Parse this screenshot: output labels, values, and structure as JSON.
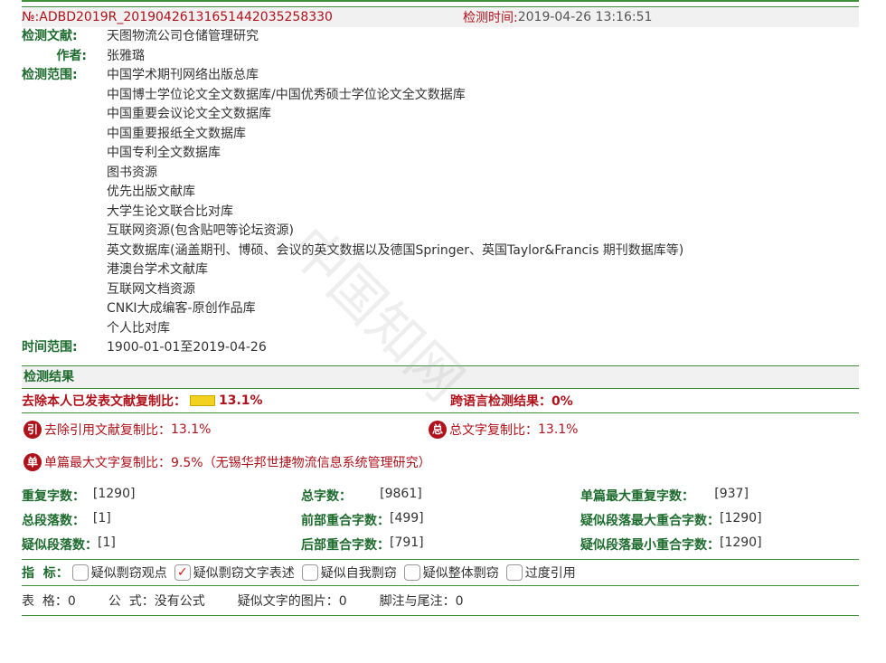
{
  "header": {
    "number": "№:ADBD2019R_2019042613165144203 5258330",
    "time_label": "检测时间:",
    "time_value": "2019-04-26 13:16:51"
  },
  "info": {
    "title_label": "检测文献:",
    "title_value": "天图物流公司仓储管理研究",
    "author_label": "作者:",
    "author_value": "张雅璐",
    "scope_label": "检测范围:",
    "scope": [
      "中国学术期刊网络出版总库",
      "中国博士学位论文全文数据库/中国优秀硕士学位论文全文数据库",
      "中国重要会议论文全文数据库",
      "中国重要报纸全文数据库",
      "中国专利全文数据库",
      "图书资源",
      "优先出版文献库",
      "大学生论文联合比对库",
      "互联网资源(包含贴吧等论坛资源)",
      "英文数据库(涵盖期刊、博硕、会议的英文数据以及德国Springer、英国Taylor&Francis 期刊数据库等)",
      "港澳台学术文献库",
      "互联网文档资源",
      "CNKI大成编客-原创作品库",
      "个人比对库"
    ],
    "time_range_label": "时间范围:",
    "time_range_value": "1900-01-01至2019-04-26"
  },
  "results": {
    "title": "检测结果",
    "excl_self_label": "去除本人已发表文献复制比：",
    "excl_self_value": "13.1%",
    "cross_lang_label": "跨语言检测结果：",
    "cross_lang_value": "0%",
    "excl_cite_icon": "引",
    "excl_cite_label": "去除引用文献复制比：",
    "excl_cite_value": "13.1%",
    "total_icon": "总",
    "total_label": "总文字复制比：",
    "total_value": "13.1%",
    "single_icon": "单",
    "single_label": "单篇最大文字复制比：",
    "single_value": "9.5%（无锡华邦世捷物流信息系统管理研究）"
  },
  "stats": {
    "dup_chars_label": "重复字数：",
    "dup_chars_value": "[1290]",
    "total_chars_label": "总字数：",
    "total_chars_value": "[9861]",
    "single_max_dup_label": "单篇最大重复字数：",
    "single_max_dup_value": "[937]",
    "total_para_label": "总段落数：",
    "total_para_value": "[1]",
    "front_overlap_label": "前部重合字数：",
    "front_overlap_value": "[499]",
    "sus_para_max_label": "疑似段落最大重合字数：",
    "sus_para_max_value": "[1290]",
    "sus_para_label": "疑似段落数：",
    "sus_para_value": "[1]",
    "back_overlap_label": "后部重合字数：",
    "back_overlap_value": "[791]",
    "sus_para_min_label": "疑似段落最小重合字数：",
    "sus_para_min_value": "[1290]"
  },
  "indicators": {
    "label": "指  标：",
    "items": [
      {
        "label": "疑似剽窃观点",
        "checked": false
      },
      {
        "label": "疑似剽窃文字表述",
        "checked": true
      },
      {
        "label": "疑似自我剽窃",
        "checked": false
      },
      {
        "label": "疑似整体剽窃",
        "checked": false
      },
      {
        "label": "过度引用",
        "checked": false
      }
    ],
    "check_mark": "✓"
  },
  "footer": {
    "tables": "表  格：0",
    "formulas": "公  式：没有公式",
    "images": "疑似文字的图片：0",
    "footnotes": "脚注与尾注：0"
  },
  "watermark": "中国知网"
}
